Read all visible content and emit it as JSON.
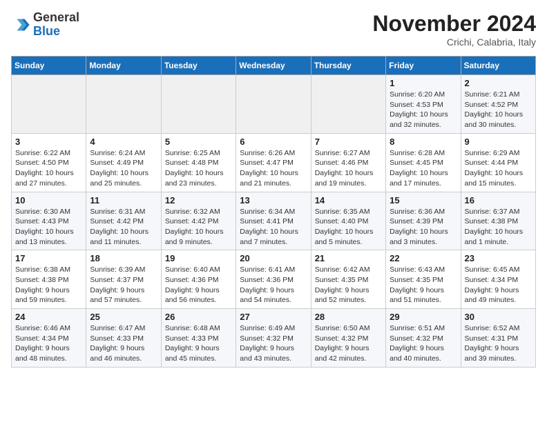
{
  "header": {
    "logo_general": "General",
    "logo_blue": "Blue",
    "month_title": "November 2024",
    "subtitle": "Crichi, Calabria, Italy"
  },
  "weekdays": [
    "Sunday",
    "Monday",
    "Tuesday",
    "Wednesday",
    "Thursday",
    "Friday",
    "Saturday"
  ],
  "weeks": [
    [
      {
        "day": "",
        "detail": ""
      },
      {
        "day": "",
        "detail": ""
      },
      {
        "day": "",
        "detail": ""
      },
      {
        "day": "",
        "detail": ""
      },
      {
        "day": "",
        "detail": ""
      },
      {
        "day": "1",
        "detail": "Sunrise: 6:20 AM\nSunset: 4:53 PM\nDaylight: 10 hours\nand 32 minutes."
      },
      {
        "day": "2",
        "detail": "Sunrise: 6:21 AM\nSunset: 4:52 PM\nDaylight: 10 hours\nand 30 minutes."
      }
    ],
    [
      {
        "day": "3",
        "detail": "Sunrise: 6:22 AM\nSunset: 4:50 PM\nDaylight: 10 hours\nand 27 minutes."
      },
      {
        "day": "4",
        "detail": "Sunrise: 6:24 AM\nSunset: 4:49 PM\nDaylight: 10 hours\nand 25 minutes."
      },
      {
        "day": "5",
        "detail": "Sunrise: 6:25 AM\nSunset: 4:48 PM\nDaylight: 10 hours\nand 23 minutes."
      },
      {
        "day": "6",
        "detail": "Sunrise: 6:26 AM\nSunset: 4:47 PM\nDaylight: 10 hours\nand 21 minutes."
      },
      {
        "day": "7",
        "detail": "Sunrise: 6:27 AM\nSunset: 4:46 PM\nDaylight: 10 hours\nand 19 minutes."
      },
      {
        "day": "8",
        "detail": "Sunrise: 6:28 AM\nSunset: 4:45 PM\nDaylight: 10 hours\nand 17 minutes."
      },
      {
        "day": "9",
        "detail": "Sunrise: 6:29 AM\nSunset: 4:44 PM\nDaylight: 10 hours\nand 15 minutes."
      }
    ],
    [
      {
        "day": "10",
        "detail": "Sunrise: 6:30 AM\nSunset: 4:43 PM\nDaylight: 10 hours\nand 13 minutes."
      },
      {
        "day": "11",
        "detail": "Sunrise: 6:31 AM\nSunset: 4:42 PM\nDaylight: 10 hours\nand 11 minutes."
      },
      {
        "day": "12",
        "detail": "Sunrise: 6:32 AM\nSunset: 4:42 PM\nDaylight: 10 hours\nand 9 minutes."
      },
      {
        "day": "13",
        "detail": "Sunrise: 6:34 AM\nSunset: 4:41 PM\nDaylight: 10 hours\nand 7 minutes."
      },
      {
        "day": "14",
        "detail": "Sunrise: 6:35 AM\nSunset: 4:40 PM\nDaylight: 10 hours\nand 5 minutes."
      },
      {
        "day": "15",
        "detail": "Sunrise: 6:36 AM\nSunset: 4:39 PM\nDaylight: 10 hours\nand 3 minutes."
      },
      {
        "day": "16",
        "detail": "Sunrise: 6:37 AM\nSunset: 4:38 PM\nDaylight: 10 hours\nand 1 minute."
      }
    ],
    [
      {
        "day": "17",
        "detail": "Sunrise: 6:38 AM\nSunset: 4:38 PM\nDaylight: 9 hours\nand 59 minutes."
      },
      {
        "day": "18",
        "detail": "Sunrise: 6:39 AM\nSunset: 4:37 PM\nDaylight: 9 hours\nand 57 minutes."
      },
      {
        "day": "19",
        "detail": "Sunrise: 6:40 AM\nSunset: 4:36 PM\nDaylight: 9 hours\nand 56 minutes."
      },
      {
        "day": "20",
        "detail": "Sunrise: 6:41 AM\nSunset: 4:36 PM\nDaylight: 9 hours\nand 54 minutes."
      },
      {
        "day": "21",
        "detail": "Sunrise: 6:42 AM\nSunset: 4:35 PM\nDaylight: 9 hours\nand 52 minutes."
      },
      {
        "day": "22",
        "detail": "Sunrise: 6:43 AM\nSunset: 4:35 PM\nDaylight: 9 hours\nand 51 minutes."
      },
      {
        "day": "23",
        "detail": "Sunrise: 6:45 AM\nSunset: 4:34 PM\nDaylight: 9 hours\nand 49 minutes."
      }
    ],
    [
      {
        "day": "24",
        "detail": "Sunrise: 6:46 AM\nSunset: 4:34 PM\nDaylight: 9 hours\nand 48 minutes."
      },
      {
        "day": "25",
        "detail": "Sunrise: 6:47 AM\nSunset: 4:33 PM\nDaylight: 9 hours\nand 46 minutes."
      },
      {
        "day": "26",
        "detail": "Sunrise: 6:48 AM\nSunset: 4:33 PM\nDaylight: 9 hours\nand 45 minutes."
      },
      {
        "day": "27",
        "detail": "Sunrise: 6:49 AM\nSunset: 4:32 PM\nDaylight: 9 hours\nand 43 minutes."
      },
      {
        "day": "28",
        "detail": "Sunrise: 6:50 AM\nSunset: 4:32 PM\nDaylight: 9 hours\nand 42 minutes."
      },
      {
        "day": "29",
        "detail": "Sunrise: 6:51 AM\nSunset: 4:32 PM\nDaylight: 9 hours\nand 40 minutes."
      },
      {
        "day": "30",
        "detail": "Sunrise: 6:52 AM\nSunset: 4:31 PM\nDaylight: 9 hours\nand 39 minutes."
      }
    ]
  ]
}
